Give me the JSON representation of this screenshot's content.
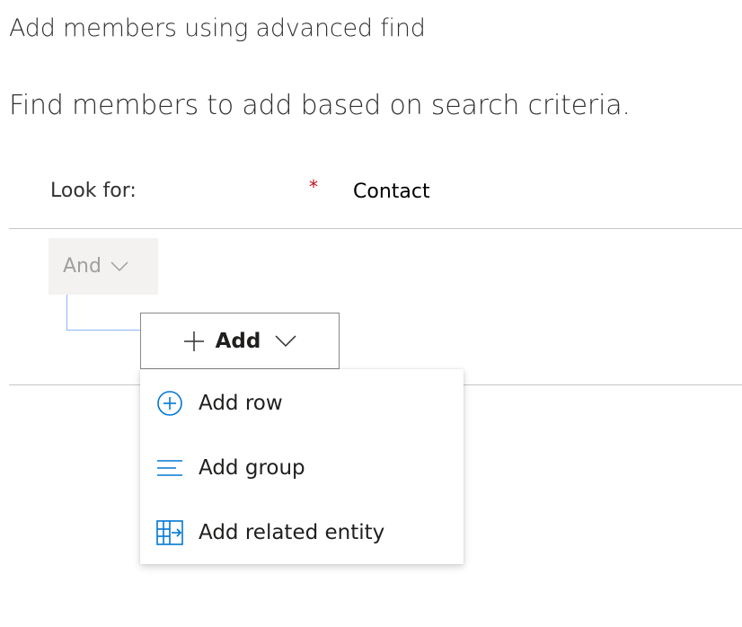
{
  "header": {
    "title": "Add members using advanced find",
    "subtitle": "Find members to add based on search criteria."
  },
  "lookfor": {
    "label": "Look for:",
    "required_marker": "*",
    "value": "Contact"
  },
  "condition": {
    "operator": "And",
    "operator_icon": "chevron-down-icon"
  },
  "add_button": {
    "label": "Add",
    "icon": "plus-icon",
    "dropdown_icon": "chevron-down-icon"
  },
  "menu": {
    "items": [
      {
        "label": "Add row",
        "icon": "add-circle-icon"
      },
      {
        "label": "Add group",
        "icon": "group-lines-icon"
      },
      {
        "label": "Add related entity",
        "icon": "related-entity-icon"
      }
    ]
  },
  "colors": {
    "accent": "#0078d4",
    "required": "#c50f1f",
    "connector": "#8ab4f8",
    "disabled_text": "#a19f9d",
    "disabled_bg": "#f3f2f1"
  }
}
